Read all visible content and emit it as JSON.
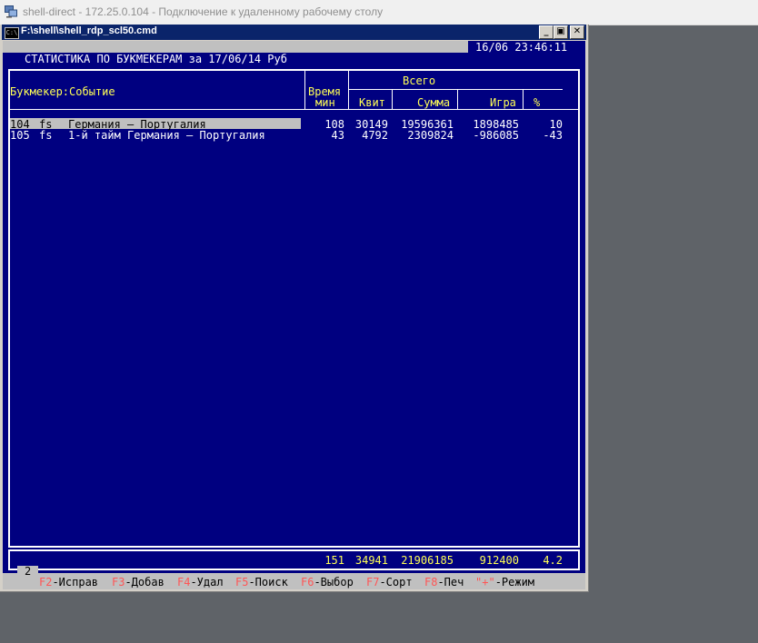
{
  "rdp": {
    "title": "shell-direct - 172.25.0.104 - Подключение к удаленному рабочему столу"
  },
  "cmd": {
    "icon_text": "C:\\",
    "title": "F:\\shell\\shell_rdp_scl50.cmd",
    "minimize": "_",
    "maximize": "▣",
    "close": "✕"
  },
  "header": {
    "datetime": "16/06 23:46:11",
    "report_title": "СТАТИСТИКА ПО БУКМЕКЕРАМ за 17/06/14 Руб"
  },
  "columns": {
    "bookmaker_event": "Букмекер:Событие",
    "time_line1": "Время",
    "time_line2": "мин",
    "total_group": "Всего",
    "kvit": "Квит",
    "summa": "Сумма",
    "igra": "Игра",
    "pct": "%"
  },
  "rows": [
    {
      "id": "104",
      "code": "fs",
      "event": "Германия — Португалия",
      "time": "108",
      "kvit": "30149",
      "summa": "19596361",
      "igra": "1898485",
      "pct": "10"
    },
    {
      "id": "105",
      "code": "fs",
      "event": "1-й тайм Германия — Португалия",
      "time": "43",
      "kvit": "4792",
      "summa": "2309824",
      "igra": "-986085",
      "pct": "-43"
    }
  ],
  "totals": {
    "time": "151",
    "kvit": "34941",
    "summa": "21906185",
    "igra": "912400",
    "pct": "4.2"
  },
  "page_indicator": "2",
  "fkeys": [
    {
      "key": "F2",
      "label": "-Исправ"
    },
    {
      "key": "F3",
      "label": "-Добав"
    },
    {
      "key": "F4",
      "label": "-Удал"
    },
    {
      "key": "F5",
      "label": "-Поиск"
    },
    {
      "key": "F6",
      "label": "-Выбор"
    },
    {
      "key": "F7",
      "label": "-Сорт"
    },
    {
      "key": "F8",
      "label": "-Печ"
    },
    {
      "key": "\"+\"",
      "label": "-Режим"
    }
  ],
  "colors": {
    "console_bg": "#000080",
    "header_text": "#ffff55",
    "key_text": "#ff5555",
    "titlebar": "#0a246a"
  }
}
